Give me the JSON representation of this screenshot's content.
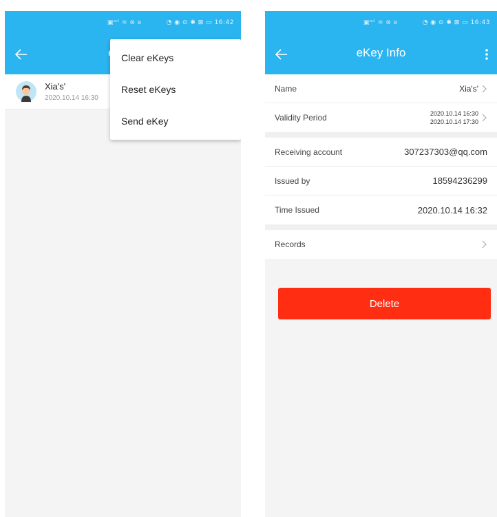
{
  "left": {
    "status_time": "16:42",
    "title_partial": "e",
    "list": [
      {
        "name": "Xia's'",
        "date": "2020.10.14 16:30"
      }
    ],
    "menu": {
      "items": [
        "Clear eKeys",
        "Reset eKeys",
        "Send eKey"
      ]
    }
  },
  "right": {
    "status_time": "16:43",
    "title": "eKey Info",
    "rows": {
      "name": {
        "label": "Name",
        "value": "Xia's'"
      },
      "validity": {
        "label": "Validity Period",
        "start": "2020.10.14 16:30",
        "end": "2020.10.14 17:30"
      },
      "receiving": {
        "label": "Receiving account",
        "value": "307237303@qq.com"
      },
      "issued_by": {
        "label": "Issued by",
        "value": "18594236299"
      },
      "time_issued": {
        "label": "Time Issued",
        "value": "2020.10.14 16:32"
      },
      "records": {
        "label": "Records"
      }
    },
    "delete_label": "Delete"
  },
  "colors": {
    "primary": "#2ab4f0",
    "danger": "#ff2d12"
  }
}
